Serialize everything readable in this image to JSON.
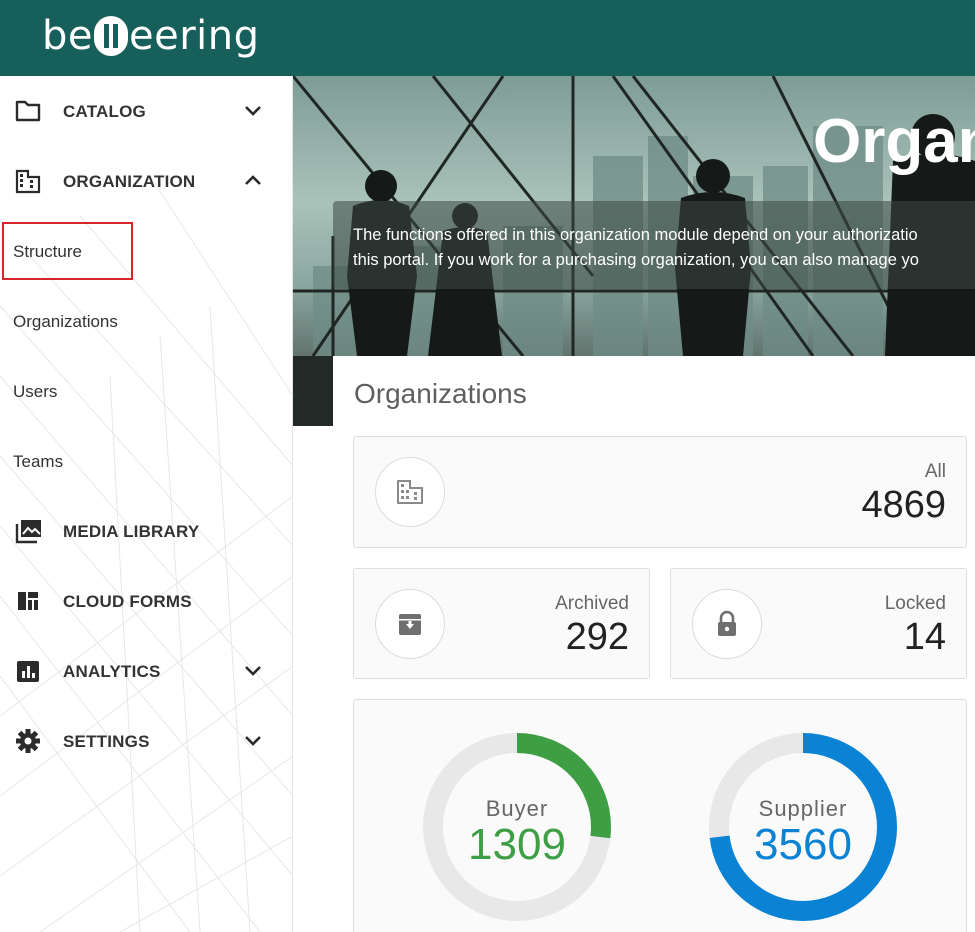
{
  "app": {
    "logo_text_left": "be",
    "logo_text_right": "eering"
  },
  "sidebar": {
    "items": [
      {
        "label": "CATALOG",
        "icon": "folder-icon",
        "chevron": "chevron-down-icon"
      },
      {
        "label": "ORGANIZATION",
        "icon": "building-icon",
        "chevron": "chevron-up-icon"
      },
      {
        "label": "MEDIA LIBRARY",
        "icon": "image-library-icon"
      },
      {
        "label": "CLOUD FORMS",
        "icon": "dashboard-icon"
      },
      {
        "label": "ANALYTICS",
        "icon": "bar-chart-icon",
        "chevron": "chevron-down-icon"
      },
      {
        "label": "SETTINGS",
        "icon": "gear-icon",
        "chevron": "chevron-down-icon"
      }
    ],
    "subitems": [
      {
        "label": "Structure",
        "selected": true
      },
      {
        "label": "Organizations"
      },
      {
        "label": "Users"
      },
      {
        "label": "Teams"
      }
    ]
  },
  "banner": {
    "title": "Organ",
    "line1": "The functions offered in this organization module depend on your authorizatio",
    "line2": "this portal. If you work for a purchasing organization, you can also manage yo"
  },
  "main": {
    "heading": "Organizations",
    "cards": {
      "all": {
        "label": "All",
        "value": "4869",
        "icon": "building-icon"
      },
      "archived": {
        "label": "Archived",
        "value": "292",
        "icon": "archive-icon"
      },
      "locked": {
        "label": "Locked",
        "value": "14",
        "icon": "lock-icon"
      }
    },
    "donuts": {
      "buyer": {
        "label": "Buyer",
        "value": "1309",
        "fraction": 0.269,
        "color": "#3e9e44"
      },
      "supplier": {
        "label": "Supplier",
        "value": "3560",
        "fraction": 0.731,
        "color": "#0a83d4"
      }
    }
  },
  "colors": {
    "header": "#175f5a",
    "highlight": "#d9242b",
    "donut_track": "#e8e8e8"
  }
}
